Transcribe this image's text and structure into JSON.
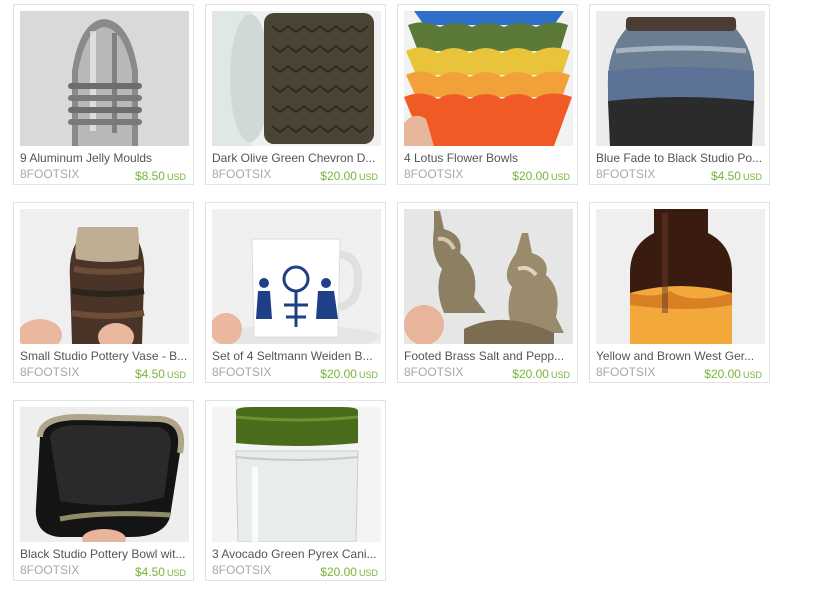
{
  "listings": [
    {
      "title": "9 Aluminum Jelly Moulds",
      "shop": "8FOOTSIX",
      "price": "$8.50",
      "currency": "USD",
      "image": "aluminum-jelly-mould-photo"
    },
    {
      "title": "Dark Olive Green Chevron D...",
      "shop": "8FOOTSIX",
      "price": "$20.00",
      "currency": "USD",
      "image": "olive-chevron-canister-photo"
    },
    {
      "title": "4 Lotus Flower Bowls",
      "shop": "8FOOTSIX",
      "price": "$20.00",
      "currency": "USD",
      "image": "lotus-flower-bowls-photo"
    },
    {
      "title": "Blue Fade to Black Studio Po...",
      "shop": "8FOOTSIX",
      "price": "$4.50",
      "currency": "USD",
      "image": "blue-fade-pottery-photo"
    },
    {
      "title": "Small Studio Pottery Vase - B...",
      "shop": "8FOOTSIX",
      "price": "$4.50",
      "currency": "USD",
      "image": "small-pottery-vase-photo"
    },
    {
      "title": "Set of 4 Seltmann Weiden B...",
      "shop": "8FOOTSIX",
      "price": "$20.00",
      "currency": "USD",
      "image": "seltmann-mug-photo"
    },
    {
      "title": "Footed Brass Salt and Pepp...",
      "shop": "8FOOTSIX",
      "price": "$20.00",
      "currency": "USD",
      "image": "brass-salt-pepper-photo"
    },
    {
      "title": "Yellow and Brown West Ger...",
      "shop": "8FOOTSIX",
      "price": "$20.00",
      "currency": "USD",
      "image": "west-german-vase-photo"
    },
    {
      "title": "Black Studio Pottery Bowl wit...",
      "shop": "8FOOTSIX",
      "price": "$4.50",
      "currency": "USD",
      "image": "black-pottery-bowl-photo"
    },
    {
      "title": "3 Avocado Green Pyrex Cani...",
      "shop": "8FOOTSIX",
      "price": "$20.00",
      "currency": "USD",
      "image": "pyrex-canister-photo"
    }
  ],
  "colors": {
    "price": "#79b33b",
    "title": "#555555",
    "shop": "#a8a8a8",
    "border": "#e2e2e2"
  }
}
